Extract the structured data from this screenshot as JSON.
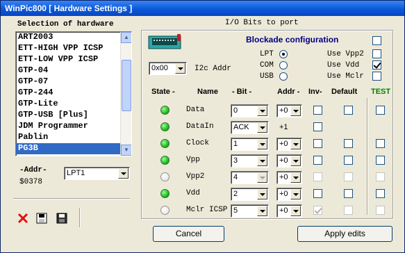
{
  "window": {
    "title": "WinPic800 [ Hardware Settings ]"
  },
  "left": {
    "selection_label": "Selection of hardware",
    "hardware_items": [
      "ART2003",
      "ETT-HIGH VPP ICSP",
      "ETT-LOW VPP ICSP",
      "GTP-04",
      "GTP-07",
      "GTP-244",
      "GTP-Lite",
      "GTP-USB [Plus]",
      "JDM Programmer",
      "Pablin",
      "PG3B"
    ],
    "selected_index": 10,
    "addr_label": "-Addr-",
    "addr_value": "$0378",
    "port_value": "LPT1"
  },
  "toolbar": {
    "delete_icon": "red-x",
    "open_icon": "disk-open",
    "save_icon": "floppy-save"
  },
  "right": {
    "io_label": "I/O Bits to port",
    "i2c_value": "0x00",
    "i2c_label": "I2c Addr",
    "blockade_label": "Blockade configuration",
    "ports": [
      {
        "label": "LPT",
        "selected": true
      },
      {
        "label": "COM",
        "selected": false
      },
      {
        "label": "USB",
        "selected": false
      }
    ],
    "options": [
      {
        "label": "Use Vpp2",
        "checked": false
      },
      {
        "label": "Use Vdd",
        "checked": true
      },
      {
        "label": "Use Mclr",
        "checked": false
      }
    ],
    "headers": {
      "state": "State -",
      "name": "Name",
      "bit": "- Bit -",
      "addr": "Addr -",
      "inv": "Inv-",
      "default": "Default",
      "test": "TEST"
    },
    "rows": [
      {
        "name": "Data",
        "bit": "0",
        "addr": "+0",
        "state": "on",
        "inv_enabled": true,
        "inv_checked": false
      },
      {
        "name": "DataIn",
        "bit": "ACK",
        "addr": "+1",
        "state": "on",
        "inv_enabled": true,
        "inv_checked": false
      },
      {
        "name": "Clock",
        "bit": "1",
        "addr": "+0",
        "state": "on",
        "inv_enabled": true,
        "inv_checked": false
      },
      {
        "name": "Vpp",
        "bit": "3",
        "addr": "+0",
        "state": "on",
        "inv_enabled": true,
        "inv_checked": false
      },
      {
        "name": "Vpp2",
        "bit": "4",
        "addr": "+0",
        "state": "off",
        "inv_enabled": false,
        "inv_checked": false
      },
      {
        "name": "Vdd",
        "bit": "2",
        "addr": "+0",
        "state": "on",
        "inv_enabled": true,
        "inv_checked": false
      },
      {
        "name": "Mclr ICSP",
        "bit": "5",
        "addr": "+0",
        "state": "off",
        "inv_enabled": false,
        "inv_checked": true
      }
    ]
  },
  "buttons": {
    "cancel": "Cancel",
    "apply": "Apply edits"
  },
  "colors": {
    "title_bar": "#0a58d8",
    "selected_item": "#316ac5",
    "test_label": "#008000",
    "blockade_label": "#000080"
  }
}
